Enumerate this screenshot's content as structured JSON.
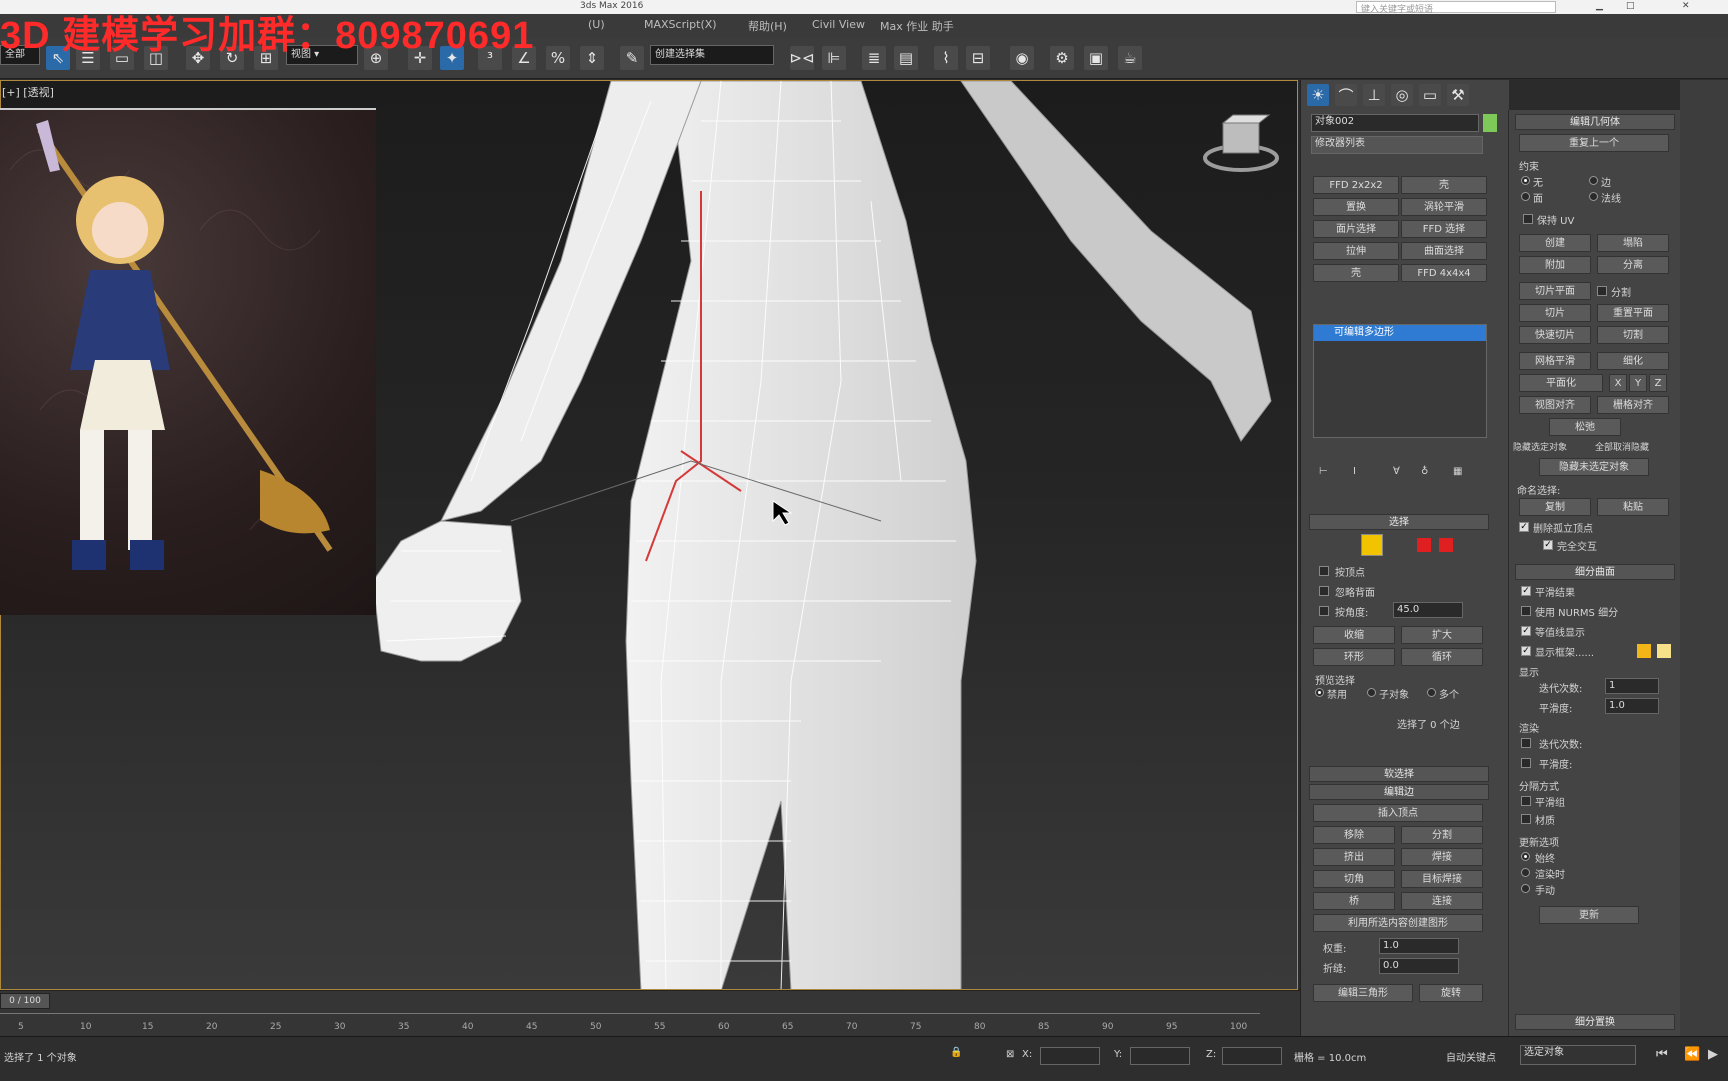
{
  "window": {
    "title": "3ds Max 2016",
    "search_placeholder": "键入关键字或短语"
  },
  "watermark": "3D 建模学习加群：809870691",
  "menu": [
    "(U)",
    "MAXScript(X)",
    "帮助(H)",
    "Civil View",
    "Max 作业 助手"
  ],
  "toolbar": {
    "selection_filter": "全部",
    "named_selection": "创建选择集"
  },
  "viewport": {
    "label": "[+] [透视]"
  },
  "command_panel": {
    "object_name": "对象002",
    "object_color": "#7ec85a",
    "modifier_list": "修改器列表",
    "buttons": [
      "FFD 2x2x2",
      "壳",
      "置换",
      "涡轮平滑",
      "面片选择",
      "FFD 选择",
      "拉伸",
      "曲面选择",
      "壳",
      "FFD 4x4x4"
    ],
    "stack_item": "可编辑多边形",
    "selection_header": "选择",
    "selection_options": [
      "按顶点",
      "忽略背面",
      "按角度:"
    ],
    "angle_value": "45.0",
    "shrink": "收缩",
    "grow": "扩大",
    "ring": "环形",
    "loop": "循环",
    "preview_selection": "预览选择",
    "preview_options": [
      "禁用",
      "子对象",
      "多个"
    ],
    "selected_status": "选择了 0 个边",
    "soft_selection": "软选择",
    "edit_edges": "编辑边",
    "insert_vertex": "插入顶点",
    "edge_buttons": [
      "移除",
      "分割",
      "挤出",
      "焊接",
      "切角",
      "目标焊接",
      "桥",
      "连接"
    ],
    "create_shape": "利用所选内容创建图形",
    "weight_label": "权重:",
    "weight_value": "1.0",
    "crease_label": "折缝:",
    "crease_value": "0.0",
    "edit_tri": "编辑三角形",
    "rotate": "旋转"
  },
  "mod_panel": {
    "header": "编辑几何体",
    "repeat_last": "重复上一个",
    "constraints": "约束",
    "constraint_options": [
      "无",
      "边",
      "面",
      "法线"
    ],
    "preserve_uv": "保持 UV",
    "create": "创建",
    "collapse": "塌陷",
    "attach": "附加",
    "detach": "分离",
    "slice_plane": "切片平面",
    "split": "分割",
    "slice": "切片",
    "reset_plane": "重置平面",
    "quickslice": "快速切片",
    "cut": "切割",
    "meshsmooth": "网格平滑",
    "tessellate": "细化",
    "make_planar": "平面化",
    "xyz": [
      "X",
      "Y",
      "Z"
    ],
    "view_align": "视图对齐",
    "grid_align": "栅格对齐",
    "relax": "松弛",
    "hide_selected": "隐藏选定对象",
    "unhide_all": "全部取消隐藏",
    "hide_unselected": "隐藏未选定对象",
    "named_sel": "命名选择:",
    "copy": "复制",
    "paste": "粘贴",
    "delete_isolated": "删除孤立顶点",
    "full_interactivity": "完全交互",
    "subdiv_header": "细分曲面",
    "smooth_result": "平滑结果",
    "use_nurms": "使用 NURMS 细分",
    "isoline": "等值线显示",
    "show_cage": "显示框架......",
    "display": "显示",
    "iterations": "迭代次数:",
    "iter_value": "1",
    "smoothness": "平滑度:",
    "smooth_value": "1.0",
    "render": "渲染",
    "separate_by": "分隔方式",
    "smoothing_groups": "平滑组",
    "materials": "材质",
    "update_options": "更新选项",
    "always": "始终",
    "when_rendering": "渲染时",
    "manually": "手动",
    "update": "更新",
    "paint_deform": "细分置换",
    "cage_color1": "#f2b619",
    "cage_color2": "#f7e08a"
  },
  "timeline": {
    "frame": "0 / 100",
    "ticks": [
      "5",
      "10",
      "15",
      "20",
      "25",
      "30",
      "35",
      "40",
      "45",
      "50",
      "55",
      "60",
      "65",
      "70",
      "75",
      "80",
      "85",
      "90",
      "95",
      "100"
    ]
  },
  "status": {
    "selected": "选择了 1 个对象",
    "x_label": "X:",
    "y_label": "Y:",
    "z_label": "Z:",
    "grid": "栅格 = 10.0cm",
    "autokey": "自动关键点",
    "set_key": "选定对象"
  }
}
